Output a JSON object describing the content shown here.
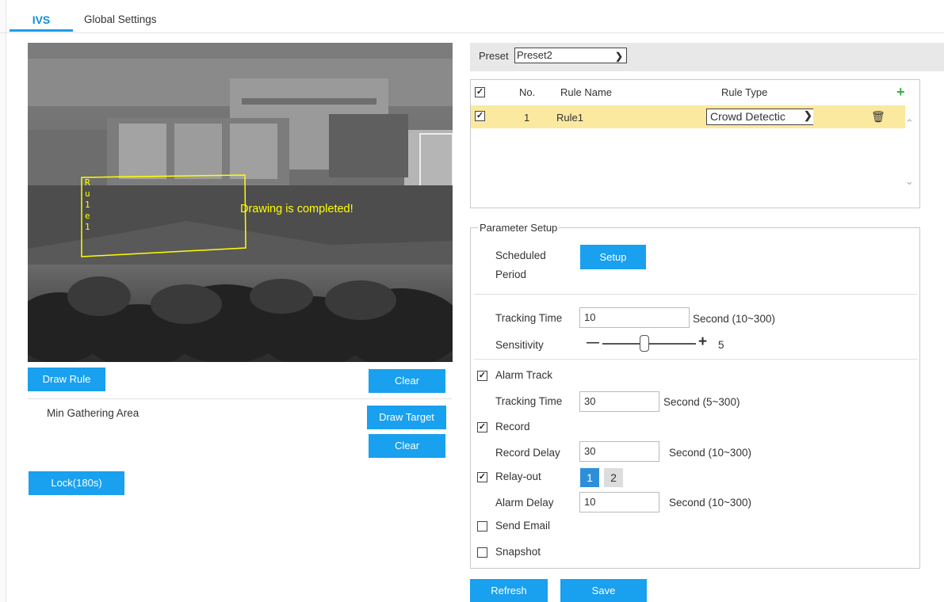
{
  "tabs": {
    "ivs": "IVS",
    "global": "Global Settings"
  },
  "video": {
    "overlay_text": "Drawing is completed!",
    "rule_label_chars": [
      "R",
      "u",
      "1",
      "e",
      "1"
    ]
  },
  "left_buttons": {
    "draw_rule": "Draw Rule",
    "clear1": "Clear",
    "min_area_label": "Min Gathering Area",
    "draw_target": "Draw Target",
    "clear2": "Clear",
    "lock": "Lock(180s)"
  },
  "preset": {
    "label": "Preset",
    "value": "Preset2"
  },
  "rule_table": {
    "headers": {
      "no": "No.",
      "name": "Rule Name",
      "type": "Rule Type"
    },
    "rows": [
      {
        "no": "1",
        "name": "Rule1",
        "type": "Crowd Detectic"
      }
    ]
  },
  "params": {
    "legend": "Parameter Setup",
    "scheduled_line1": "Scheduled",
    "scheduled_line2": "Period",
    "setup_btn": "Setup",
    "tracking_time_label": "Tracking Time",
    "tracking_time_value": "10",
    "tracking_time_unit": "Second (10~300)",
    "sensitivity_label": "Sensitivity",
    "sensitivity_minus": "—",
    "sensitivity_plus": "+",
    "sensitivity_value": "5",
    "alarm_track_label": "Alarm Track",
    "alarm_tracking_time_label": "Tracking Time",
    "alarm_tracking_time_value": "30",
    "alarm_tracking_time_unit": "Second (5~300)",
    "record_label": "Record",
    "record_delay_label": "Record Delay",
    "record_delay_value": "30",
    "record_delay_unit": "Second (10~300)",
    "relay_label": "Relay-out",
    "relay_1": "1",
    "relay_2": "2",
    "alarm_delay_label": "Alarm Delay",
    "alarm_delay_value": "10",
    "alarm_delay_unit": "Second (10~300)",
    "send_email_label": "Send Email",
    "snapshot_label": "Snapshot"
  },
  "bottom": {
    "refresh": "Refresh",
    "save": "Save"
  },
  "colors": {
    "accent": "#19a0ef",
    "highlight_row": "#fbe9a0",
    "overlay_yellow": "#ffff00"
  }
}
